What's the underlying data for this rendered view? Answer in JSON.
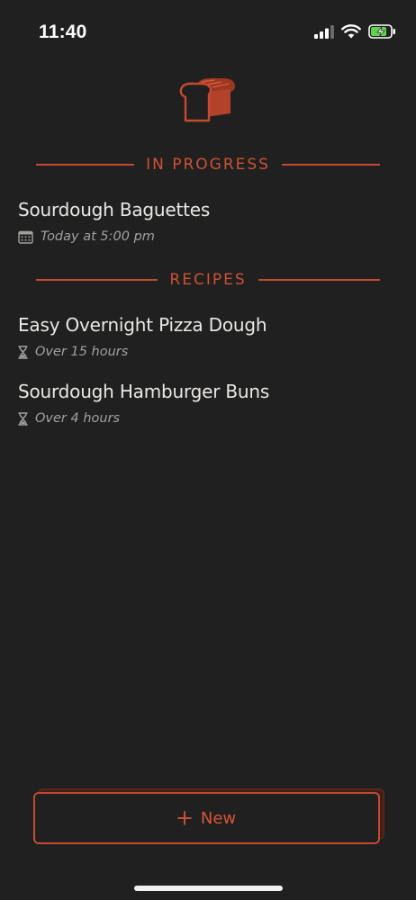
{
  "status_bar": {
    "time": "11:40",
    "icons": [
      "cellular-signal-icon",
      "wifi-icon",
      "battery-charging-icon"
    ]
  },
  "logo": {
    "icon": "bread-loaf-icon"
  },
  "in_progress": {
    "header": "IN PROGRESS",
    "items": [
      {
        "title": "Sourdough Baguettes",
        "meta": "Today at 5:00 pm",
        "icon": "calendar-icon"
      }
    ]
  },
  "recipes": {
    "header": "RECIPES",
    "items": [
      {
        "title": "Easy Overnight Pizza Dough",
        "meta": "Over 15 hours",
        "icon": "hourglass-icon"
      },
      {
        "title": "Sourdough Hamburger Buns",
        "meta": "Over 4 hours",
        "icon": "hourglass-icon"
      }
    ]
  },
  "new_button": {
    "label": "New",
    "icon": "plus-icon"
  },
  "colors": {
    "background": "#202020",
    "accent": "#c44a30",
    "text_primary": "#ebe8e4",
    "text_secondary": "#a3a09c",
    "battery_charge": "#5fd24e"
  }
}
